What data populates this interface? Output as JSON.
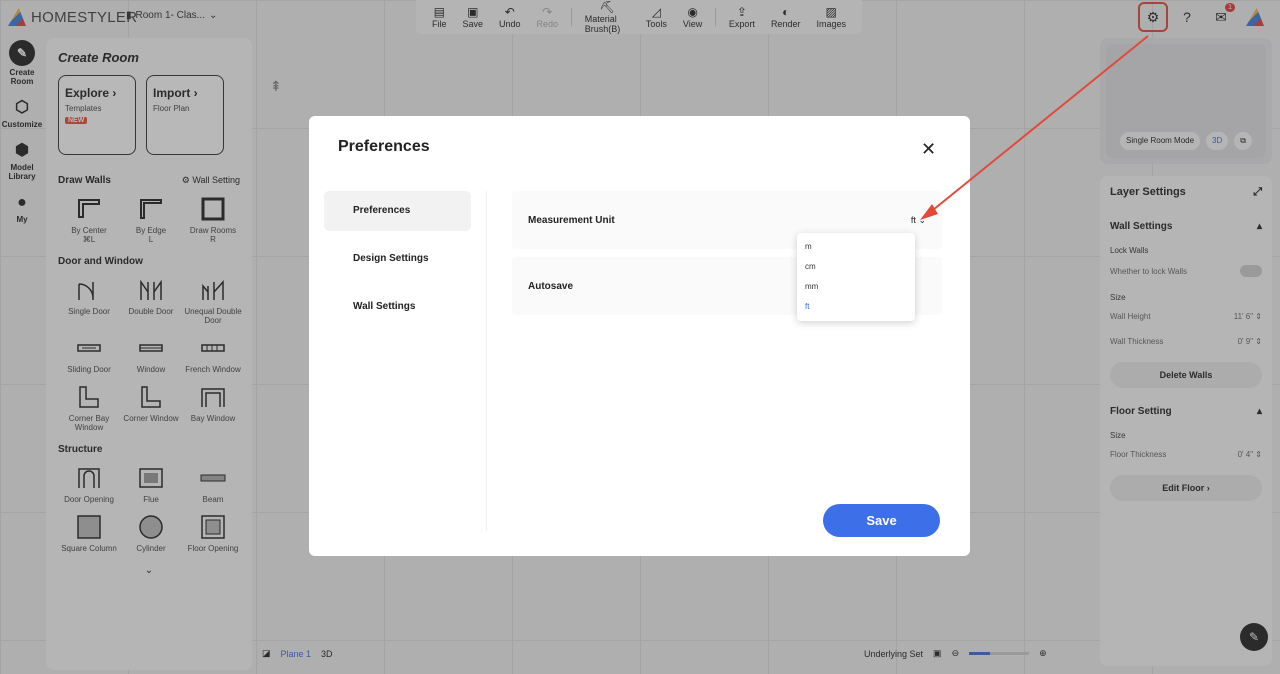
{
  "app": {
    "name": "HOMESTYLER",
    "room_name": "Room 1- Clas..."
  },
  "toolbar": {
    "file": "File",
    "save": "Save",
    "undo": "Undo",
    "redo": "Redo",
    "material_brush": "Material Brush(B)",
    "tools": "Tools",
    "view": "View",
    "export": "Export",
    "render": "Render",
    "images": "Images"
  },
  "top_right": {
    "notification_count": "1"
  },
  "rail": {
    "create_room": "Create Room",
    "customize": "Customize",
    "model_library": "Model Library",
    "my": "My"
  },
  "left_panel": {
    "title": "Create Room",
    "explore": {
      "title": "Explore",
      "sub": "Templates",
      "tag": "NEW"
    },
    "import": {
      "title": "Import",
      "sub": "Floor Plan"
    },
    "draw_walls": {
      "heading": "Draw Walls",
      "wall_setting": "Wall Setting",
      "items": [
        {
          "label": "By Center",
          "shortcut": "⌘L"
        },
        {
          "label": "By Edge",
          "shortcut": "L"
        },
        {
          "label": "Draw Rooms",
          "shortcut": "R"
        }
      ]
    },
    "door_window": {
      "heading": "Door and Window",
      "items": [
        "Single Door",
        "Double Door",
        "Unequal Double Door",
        "Sliding Door",
        "Window",
        "French Window",
        "Corner Bay Window",
        "Corner Window",
        "Bay Window"
      ]
    },
    "structure": {
      "heading": "Structure",
      "items": [
        "Door Opening",
        "Flue",
        "Beam",
        "Square Column",
        "Cylinder",
        "Floor Opening"
      ]
    }
  },
  "preview": {
    "single_room_mode": "Single Room Mode",
    "mode_3d": "3D"
  },
  "right_panel": {
    "title": "Layer Settings",
    "wall_settings": "Wall Settings",
    "lock_walls": "Lock Walls",
    "lock_walls_desc": "Whether to lock Walls",
    "size": "Size",
    "wall_height_label": "Wall Height",
    "wall_height": "11' 6\"",
    "wall_thickness_label": "Wall Thickness",
    "wall_thickness": "0' 9\"",
    "delete_walls": "Delete Walls",
    "floor_setting": "Floor Setting",
    "floor_size": "Size",
    "floor_thickness_label": "Floor Thickness",
    "floor_thickness": "0' 4\"",
    "edit_floor": "Edit Floor ›"
  },
  "bottom": {
    "plane": "Plane 1",
    "view3d": "3D",
    "underlying_set": "Underlying Set",
    "zoom_fraction": 0.35
  },
  "modal": {
    "title": "Preferences",
    "nav": [
      "Preferences",
      "Design Settings",
      "Wall Settings"
    ],
    "measurement_unit_label": "Measurement Unit",
    "measurement_unit_value": "ft",
    "autosave_label": "Autosave",
    "unit_options": [
      "m",
      "cm",
      "mm",
      "ft"
    ],
    "save": "Save"
  },
  "colors": {
    "accent": "#3d6fe8",
    "highlight": "#e14a3b"
  }
}
